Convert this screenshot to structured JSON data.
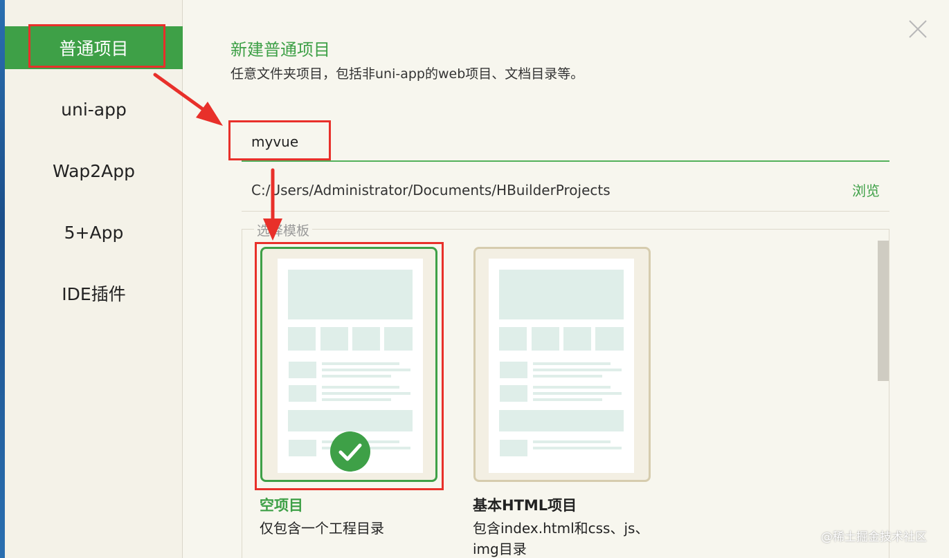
{
  "sidebar": {
    "items": [
      {
        "label": "普通项目"
      },
      {
        "label": "uni-app"
      },
      {
        "label": "Wap2App"
      },
      {
        "label": "5+App"
      },
      {
        "label": "IDE插件"
      }
    ]
  },
  "header": {
    "title": "新建普通项目",
    "subtitle": "任意文件夹项目，包括非uni-app的web项目、文档目录等。"
  },
  "form": {
    "project_name": "myvue",
    "path": "C:/Users/Administrator/Documents/HBuilderProjects",
    "browse_label": "浏览",
    "templates_label": "选择模板"
  },
  "templates": [
    {
      "title": "空项目",
      "description": "仅包含一个工程目录",
      "selected": true
    },
    {
      "title": "基本HTML项目",
      "description": "包含index.html和css、js、img目录",
      "selected": false
    }
  ],
  "watermark": "@稀土掘金技术社区",
  "colors": {
    "accent": "#3ea047",
    "annotation": "#e8302a",
    "selected_badge": "#3ea047"
  },
  "icons": {
    "close": "close-icon",
    "check": "check-circle-icon"
  }
}
